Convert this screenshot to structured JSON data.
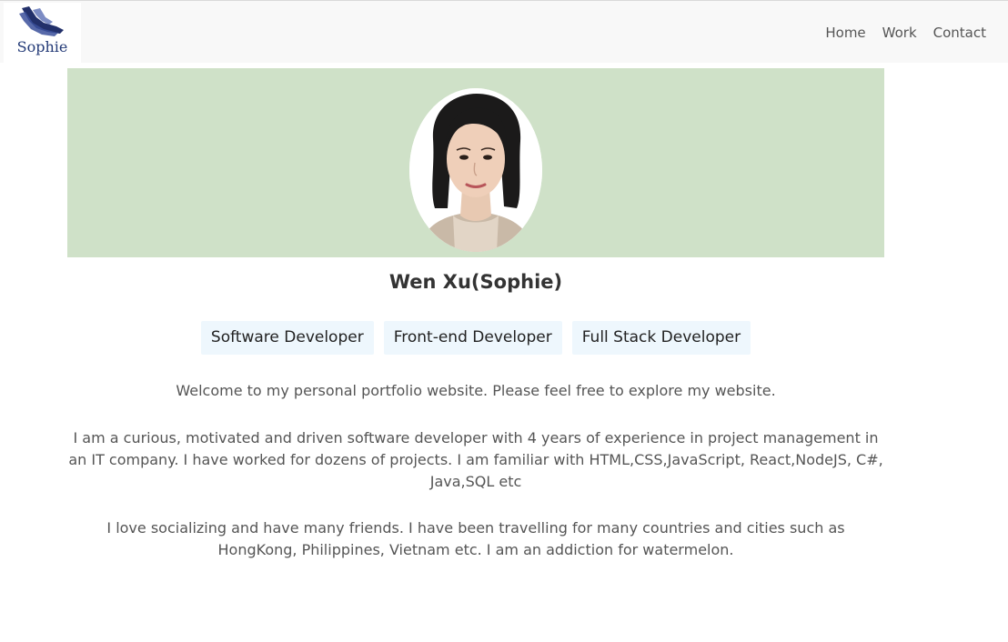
{
  "nav": {
    "logo_text": "Sophie",
    "links": [
      "Home",
      "Work",
      "Contact"
    ]
  },
  "profile": {
    "name": "Wen Xu(Sophie)",
    "avatar_icon": "portrait-photo",
    "hero_color": "#cfe1c8"
  },
  "tags": [
    "Software Developer",
    "Front-end Developer",
    "Full Stack Developer"
  ],
  "paragraphs": [
    "Welcome to my personal portfolio website. Please feel free to explore my website.",
    "I am a curious, motivated and driven software developer with 4 years of experience in project management in an IT company. I have worked for dozens of projects. I am familiar with HTML,CSS,JavaScript, React,NodeJS, C#, Java,SQL etc",
    "I love socializing and have many friends. I have been travelling for many countries and cities such as HongKong, Philippines, Vietnam etc. I am an addiction for watermelon."
  ]
}
